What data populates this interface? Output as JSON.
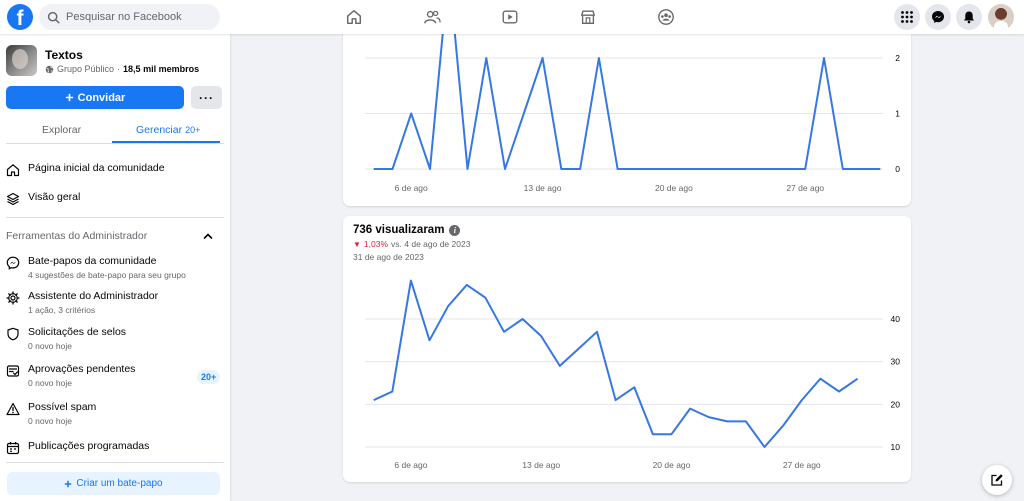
{
  "topbar": {
    "logo_letter": "f",
    "search_placeholder": "Pesquisar no Facebook",
    "nav_icons": [
      "home-icon",
      "friends-icon",
      "video-icon",
      "marketplace-icon",
      "groups-icon"
    ],
    "right_icons": [
      "menu-grid-icon",
      "messenger-icon",
      "notifications-icon",
      "profile-avatar"
    ]
  },
  "sidebar": {
    "group_name": "Textos",
    "group_privacy": "Grupo Público",
    "separator": "·",
    "member_count": "18,5 mil membros",
    "invite_label": "Convidar",
    "more_label": "···",
    "tabs": [
      {
        "label": "Explorar"
      },
      {
        "label": "Gerenciar",
        "badge": "20+"
      }
    ],
    "top_items": [
      {
        "title": "Página inicial da comunidade",
        "icon": "home-outline-icon"
      },
      {
        "title": "Visão geral",
        "icon": "layers-icon"
      }
    ],
    "admin_section_title": "Ferramentas do Administrador",
    "admin_items": [
      {
        "title": "Bate-papos da comunidade",
        "sub": "4 sugestões de bate-papo para seu grupo",
        "icon": "messenger-outline-icon"
      },
      {
        "title": "Assistente do Administrador",
        "sub": "1 ação, 3 critérios",
        "icon": "gear-icon"
      },
      {
        "title": "Solicitações de selos",
        "sub": "0 novo hoje",
        "icon": "shield-icon"
      },
      {
        "title": "Aprovações pendentes",
        "sub": "0 novo hoje",
        "icon": "approvals-icon",
        "badge": "20+"
      },
      {
        "title": "Possível spam",
        "sub": "0 novo hoje",
        "icon": "warning-icon"
      },
      {
        "title": "Publicações programadas",
        "sub": "",
        "icon": "calendar-icon"
      }
    ],
    "create_chat_label": "Criar um bate-papo"
  },
  "card2": {
    "title": "736 visualizaram",
    "delta_pct": "1,03%",
    "delta_rest": "vs. 4 de ago de 2023",
    "date": "31 de ago de 2023"
  },
  "colors": {
    "accent": "#1877f2",
    "line": "#3578e5",
    "negative": "#e41e3f"
  },
  "chart_data": [
    {
      "type": "line",
      "x": [
        "4 de ago",
        "5 de ago",
        "6 de ago",
        "7 de ago",
        "8 de ago",
        "9 de ago",
        "10 de ago",
        "11 de ago",
        "12 de ago",
        "13 de ago",
        "14 de ago",
        "15 de ago",
        "16 de ago",
        "17 de ago",
        "18 de ago",
        "19 de ago",
        "20 de ago",
        "21 de ago",
        "22 de ago",
        "23 de ago",
        "24 de ago",
        "25 de ago",
        "26 de ago",
        "27 de ago",
        "28 de ago",
        "29 de ago",
        "30 de ago",
        "31 de ago"
      ],
      "series": [
        {
          "values": [
            0,
            0,
            1,
            0,
            3.6,
            0,
            2,
            0,
            1,
            2,
            0,
            0,
            2,
            0,
            0,
            0,
            0,
            0,
            0,
            0,
            0,
            0,
            0,
            0,
            2,
            0,
            0,
            0
          ]
        }
      ],
      "x_tick_labels": [
        "6 de ago",
        "13 de ago",
        "20 de ago",
        "27 de ago"
      ],
      "x_tick_index": [
        2,
        9,
        16,
        23
      ],
      "y_tick_labels": [
        "0",
        "1",
        "2"
      ],
      "y_ticks": [
        0,
        1,
        2
      ],
      "ylim": [
        0,
        2
      ],
      "grid": true
    },
    {
      "type": "line",
      "x": [
        "4 de ago",
        "5 de ago",
        "6 de ago",
        "7 de ago",
        "8 de ago",
        "9 de ago",
        "10 de ago",
        "11 de ago",
        "12 de ago",
        "13 de ago",
        "14 de ago",
        "15 de ago",
        "16 de ago",
        "17 de ago",
        "18 de ago",
        "19 de ago",
        "20 de ago",
        "21 de ago",
        "22 de ago",
        "23 de ago",
        "24 de ago",
        "25 de ago",
        "26 de ago",
        "27 de ago",
        "28 de ago",
        "29 de ago",
        "30 de ago",
        "31 de ago"
      ],
      "series": [
        {
          "values": [
            21,
            23,
            49,
            35,
            43,
            48,
            45,
            37,
            40,
            36,
            29,
            33,
            37,
            21,
            24,
            13,
            13,
            19,
            17,
            16,
            16,
            10,
            15,
            21,
            26,
            23,
            26
          ]
        }
      ],
      "x_tick_labels": [
        "6 de ago",
        "13 de ago",
        "20 de ago",
        "27 de ago"
      ],
      "x_tick_index": [
        2,
        9,
        16,
        23
      ],
      "y_tick_labels": [
        "10",
        "20",
        "30",
        "40"
      ],
      "y_ticks": [
        10,
        20,
        30,
        40
      ],
      "ylim": [
        10,
        40
      ],
      "grid": true
    }
  ]
}
